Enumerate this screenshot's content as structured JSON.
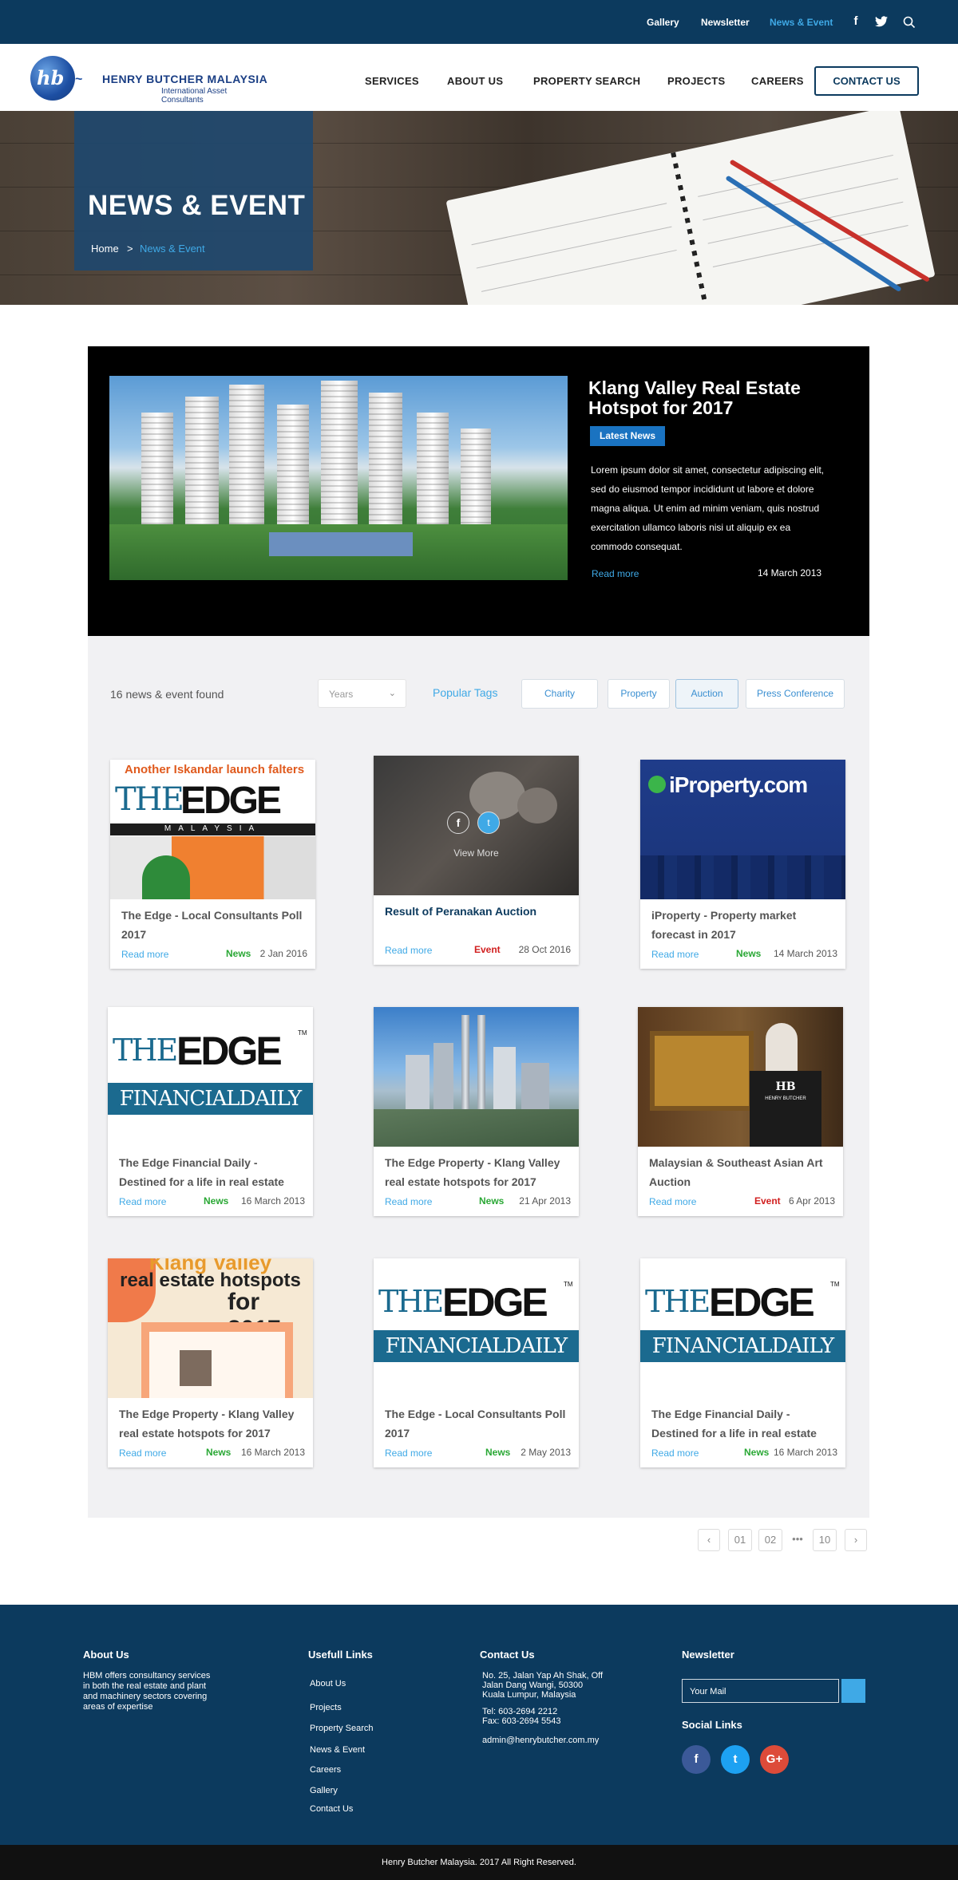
{
  "topbar": {
    "links": [
      "Gallery",
      "Newsletter",
      "News & Event"
    ],
    "active": "News & Event",
    "icons": [
      "facebook-icon",
      "twitter-icon",
      "search-icon"
    ]
  },
  "brand": {
    "logo_mark": "hb",
    "name": "HENRY BUTCHER MALAYSIA",
    "tagline": "International Asset Consultants"
  },
  "nav": {
    "items": [
      "SERVICES",
      "ABOUT US",
      "PROPERTY SEARCH",
      "PROJECTS",
      "CAREERS"
    ],
    "cta": "CONTACT US"
  },
  "hero": {
    "title": "NEWS & EVENT",
    "breadcrumb": {
      "home": "Home",
      "separator": ">",
      "current": "News & Event"
    }
  },
  "featured": {
    "title": "Klang Valley Real Estate Hotspot for 2017",
    "badge": "Latest News",
    "body": "Lorem ipsum dolor sit amet, consectetur adipiscing elit, sed do eiusmod tempor incididunt ut labore et dolore magna aliqua. Ut enim ad minim veniam, quis nostrud exercitation ullamco laboris nisi ut aliquip ex ea commodo consequat.",
    "read_more": "Read more",
    "date": "14 March 2013"
  },
  "filters": {
    "count_text": "16 news & event found",
    "years_placeholder": "Years",
    "popular_tags_label": "Popular Tags",
    "tags": [
      "Charity",
      "Property",
      "Auction",
      "Press Conference"
    ],
    "selected_tag": "Auction"
  },
  "cards": [
    {
      "title": "The Edge - Local Consultants Poll 2017",
      "read": "Read more",
      "category": "News",
      "date": "2 Jan 2016",
      "thumb_text": [
        "Another Iskandar launch falters",
        "THE",
        "EDGE",
        "MALAYSIA"
      ]
    },
    {
      "title": "Result of Peranakan Auction",
      "read": "Read more",
      "category": "Event",
      "date": "28 Oct 2016",
      "thumb_text": [
        "View More"
      ],
      "hover": true
    },
    {
      "title": "iProperty - Property market forecast in 2017",
      "read": "Read more",
      "category": "News",
      "date": "14 March 2013",
      "thumb_text": [
        "iProperty.com"
      ]
    },
    {
      "title": "The Edge Financial Daily - Destined for a life in real estate",
      "read": "Read more",
      "category": "News",
      "date": "16 March 2013",
      "thumb_text": [
        "THE",
        "EDGE",
        "FINANCIALDAILY",
        "TM"
      ]
    },
    {
      "title": "The Edge Property - Klang Valley real estate hotspots for 2017",
      "read": "Read more",
      "category": "News",
      "date": "21 Apr 2013",
      "thumb_text": []
    },
    {
      "title": "Malaysian & Southeast Asian Art Auction",
      "read": "Read more",
      "category": "Event",
      "date": "6 Apr 2013",
      "thumb_text": [
        "HB",
        "HENRY BUTCHER"
      ]
    },
    {
      "title": "The Edge Property - Klang Valley real estate hotspots for 2017",
      "read": "Read more",
      "category": "News",
      "date": "16 March 2013",
      "thumb_text": [
        "Klang Valley",
        "real estate hotspots",
        "for 2017"
      ]
    },
    {
      "title": "The Edge - Local Consultants Poll 2017",
      "read": "Read more",
      "category": "News",
      "date": "2 May 2013",
      "thumb_text": [
        "THE",
        "EDGE",
        "FINANCIALDAILY",
        "TM"
      ]
    },
    {
      "title": "The Edge Financial Daily - Destined for a life in real estate",
      "read": "Read more",
      "category": "News",
      "date": "16 March 2013",
      "thumb_text": [
        "THE",
        "EDGE",
        "FINANCIALDAILY",
        "TM"
      ]
    }
  ],
  "pagination": {
    "prev": "‹",
    "pages": [
      "01",
      "02"
    ],
    "ellipsis": "•••",
    "last": "10",
    "next": "›"
  },
  "footer": {
    "about": {
      "heading": "About Us",
      "text": "HBM offers consultancy services in both the real estate and plant and machinery sectors covering areas of expertise"
    },
    "links": {
      "heading": "Usefull Links",
      "items": [
        "About Us",
        "Projects",
        "Property Search",
        "News & Event",
        "Careers",
        "Gallery",
        "Contact Us"
      ]
    },
    "contact": {
      "heading": "Contact Us",
      "address": [
        "No. 25, Jalan Yap Ah Shak, Off",
        "Jalan Dang Wangi, 50300",
        "Kuala Lumpur, Malaysia"
      ],
      "tel": "Tel: 603-2694 2212",
      "fax": "Fax: 603-2694 5543",
      "email": "admin@henrybutcher.com.my"
    },
    "newsletter": {
      "heading": "Newsletter",
      "placeholder": "Your Mail"
    },
    "social": {
      "heading": "Social Links",
      "items": [
        {
          "name": "facebook",
          "glyph": "f",
          "color": "#3b5998"
        },
        {
          "name": "twitter",
          "glyph": "t",
          "color": "#1da1f2"
        },
        {
          "name": "google-plus",
          "glyph": "G+",
          "color": "#dd4b39"
        }
      ]
    },
    "copyright": "Henry Butcher Malaysia. 2017 All Right Reserved."
  }
}
